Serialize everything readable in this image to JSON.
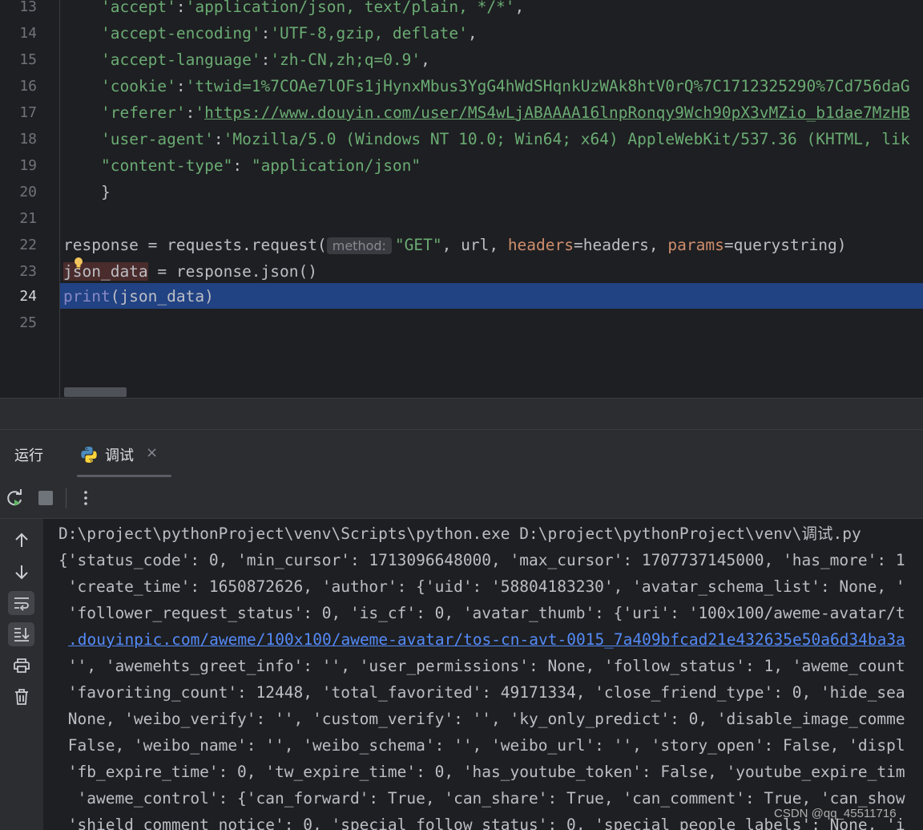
{
  "editor": {
    "line_numbers": [
      "13",
      "14",
      "15",
      "16",
      "17",
      "18",
      "19",
      "20",
      "21",
      "22",
      "23",
      "24",
      "25"
    ],
    "lines": {
      "l13_key": "'accept'",
      "l13_colon": ":",
      "l13_val": "'application/json, text/plain, */*'",
      "l13_end": ",",
      "l14_key": "'accept-encoding'",
      "l14_colon": ":",
      "l14_val": "'UTF-8,gzip, deflate'",
      "l14_end": ",",
      "l15_key": "'accept-language'",
      "l15_colon": ":",
      "l15_val": "'zh-CN,zh;q=0.9'",
      "l15_end": ",",
      "l16_key": "'cookie'",
      "l16_colon": ":",
      "l16_val": "'ttwid=1%7COAe7lOFs1jHynxMbus3YgG4hWdSHqnkUzWAk8htV0rQ%7C1712325290%7Cd756daG",
      "l17_key": "'referer'",
      "l17_colon": ":",
      "l17_q": "'",
      "l17_url": "https://www.douyin.com/user/MS4wLjABAAAA16lnpRonqy9Wch90pX3vMZio_b1dae7MzHB",
      "l18_key": "'user-agent'",
      "l18_colon": ":",
      "l18_val": "'Mozilla/5.0 (Windows NT 10.0; Win64; x64) AppleWebKit/537.36 (KHTML, lik",
      "l19_key": "\"content-type\"",
      "l19_colon": ": ",
      "l19_val": "\"application/json\"",
      "l20": "}",
      "l22_a": "response = requests.request(",
      "l22_hint": "method:",
      "l22_b": "\"GET\"",
      "l22_c": ", url, ",
      "l22_d": "headers",
      "l22_e": "=headers, ",
      "l22_f": "params",
      "l22_g": "=querystring)",
      "l23_var": "json_data",
      "l23_rest": " = response.json()",
      "l24_fn": "print",
      "l24_rest": "(json_data)"
    }
  },
  "run_window": {
    "title": "运行",
    "tab_label": "调试",
    "tab_close": "×"
  },
  "console": {
    "lines": [
      "D:\\project\\pythonProject\\venv\\Scripts\\python.exe D:\\project\\pythonProject\\venv\\调试.py",
      "{'status_code': 0, 'min_cursor': 1713096648000, 'max_cursor': 1707737145000, 'has_more': 1",
      " 'create_time': 1650872626, 'author': {'uid': '58804183230', 'avatar_schema_list': None, '",
      " 'follower_request_status': 0, 'is_cf': 0, 'avatar_thumb': {'uri': '100x100/aweme-avatar/t",
      ".douyinpic.com/aweme/100x100/aweme-avatar/tos-cn-avt-0015_7a409bfcad21e432635e50a6d34ba3a",
      " '', 'awemehts_greet_info': '', 'user_permissions': None, 'follow_status': 1, 'aweme_count",
      " 'favoriting_count': 12448, 'total_favorited': 49171334, 'close_friend_type': 0, 'hide_sea",
      " None, 'weibo_verify': '', 'custom_verify': '', 'ky_only_predict': 0, 'disable_image_comme",
      " False, 'weibo_name': '', 'weibo_schema': '', 'weibo_url': '', 'story_open': False, 'displ",
      " 'fb_expire_time': 0, 'tw_expire_time': 0, 'has_youtube_token': False, 'youtube_expire_tim",
      "  'aweme_control': {'can_forward': True, 'can_share': True, 'can_comment': True, 'can_show",
      " 'shield_comment_notice': 0, 'special_follow_status': 0, 'special_people_labels': None, 'i"
    ]
  },
  "watermark": "CSDN @qq_45511716",
  "colors": {
    "editor_bg": "#1e1f22",
    "selection": "#214283",
    "string": "#6aab73",
    "param": "#cf8e6d",
    "link": "#548af7"
  },
  "icons": [
    "lightbulb-icon",
    "python-icon",
    "rerun-icon",
    "stop-icon",
    "more-vertical-icon",
    "arrow-up-icon",
    "arrow-down-icon",
    "soft-wrap-icon",
    "scroll-to-end-icon",
    "print-icon",
    "trash-icon"
  ]
}
